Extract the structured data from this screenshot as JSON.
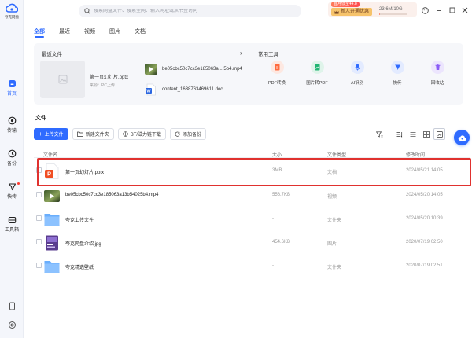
{
  "app": {
    "name": "夸克网盘"
  },
  "sidebar": {
    "items": [
      {
        "label": "首页",
        "icon": "home-icon"
      },
      {
        "label": "传输",
        "icon": "transfer-icon"
      },
      {
        "label": "备份",
        "icon": "backup-icon"
      },
      {
        "label": "快传",
        "icon": "quick-send-icon"
      },
      {
        "label": "工具箱",
        "icon": "toolbox-icon"
      }
    ]
  },
  "search": {
    "placeholder": "搜索网盘文件、搜索全网、输入网址或从书签访问"
  },
  "vip": {
    "badge": "首月低至¥4.8",
    "button": "新人开通优惠",
    "storage": "23.6M/10G",
    "storage_used_fraction": 0.005
  },
  "tabs": [
    "全部",
    "最近",
    "视频",
    "图片",
    "文档"
  ],
  "recent": {
    "title": "最近文件",
    "main": {
      "name": "第一页幻灯片.pptx",
      "meta": "来源：PC上传"
    },
    "items": [
      {
        "name": "be05cbc50c7cc3e185063a... 5b4.mp4",
        "kind": "video"
      },
      {
        "name": "content_1638763469611.doc",
        "kind": "doc"
      }
    ]
  },
  "tools": {
    "title": "常用工具",
    "items": [
      {
        "label": "PDF转换",
        "color": "#ff6a3d",
        "icon": "pdf-convert-icon"
      },
      {
        "label": "图片转PDF",
        "color": "#22b573",
        "icon": "image-to-pdf-icon"
      },
      {
        "label": "AI识别",
        "color": "#2f6bff",
        "icon": "ai-recognize-icon"
      },
      {
        "label": "快传",
        "color": "#2f6bff",
        "icon": "quick-send-icon"
      },
      {
        "label": "回收站",
        "color": "#8a5cf6",
        "icon": "recycle-bin-icon"
      }
    ]
  },
  "files": {
    "title": "文件",
    "toolbar": {
      "upload": "上传文件",
      "new_folder": "新建文件夹",
      "bt": "BT/磁力链下载",
      "backup": "添加备份"
    },
    "columns": {
      "name": "文件名",
      "size": "大小",
      "type": "文件类型",
      "time": "修改时间"
    },
    "rows": [
      {
        "name": "第一页幻灯片.pptx",
        "size": "3MB",
        "type": "文档",
        "time": "2024/05/21 14:05",
        "kind": "ppt"
      },
      {
        "name": "be05cbc50c7cc3e185063a13b54025b4.mp4",
        "size": "556.7KB",
        "type": "视频",
        "time": "2024/05/20 14:05",
        "kind": "video"
      },
      {
        "name": "夸克上传文件",
        "size": "-",
        "type": "文件夹",
        "time": "2024/05/20 10:39",
        "kind": "folder"
      },
      {
        "name": "夸克网盘介绍.jpg",
        "size": "454.6KB",
        "type": "图片",
        "time": "2020/07/19 02:50",
        "kind": "image"
      },
      {
        "name": "夸克精选壁纸",
        "size": "-",
        "type": "文件夹",
        "time": "2020/07/19 02:51",
        "kind": "folder"
      }
    ]
  },
  "colors": {
    "accent": "#2f6bff",
    "highlight": "#e0322f"
  }
}
